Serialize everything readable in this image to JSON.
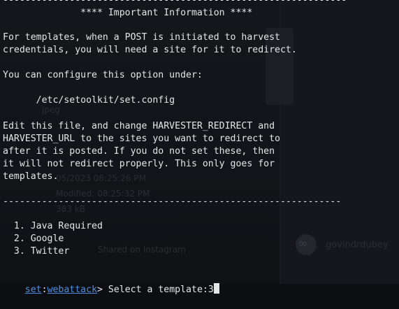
{
  "terminal": {
    "rule_top": "--------------------------------------------------------------",
    "banner": "              **** Important Information ****",
    "para1_line1": "For templates, when a POST is initiated to harvest",
    "para1_line2": "credentials, you will need a site for it to redirect.",
    "para2_line1": "You can configure this option under:",
    "config_path": "      /etc/setoolkit/set.config",
    "para3_line1": "Edit this file, and change HARVESTER_REDIRECT and",
    "para3_line2": "HARVESTER_URL to the sites you want to redirect to",
    "para3_line3": "after it is posted. If you do not set these, then",
    "para3_line4": "it will not redirect properly. This only goes for",
    "para3_line5": "templates.",
    "rule_bottom": "-------------------------------------------------------------",
    "menu": [
      "  1. Java Required",
      "  2. Google",
      "  3. Twitter"
    ],
    "prompt": {
      "context": "set",
      "separator": ":",
      "module": "webattack",
      "arrow": ">",
      "question": " Select a template:",
      "input_value": "3"
    }
  },
  "background_ghost": {
    "lines": [
      "jpeg",
      "05/2023 08:25:26 PM",
      "Modified: 08:25:32 PM",
      "383 kB",
      "Shared on Instagram"
    ],
    "username": "govindrdubey"
  }
}
